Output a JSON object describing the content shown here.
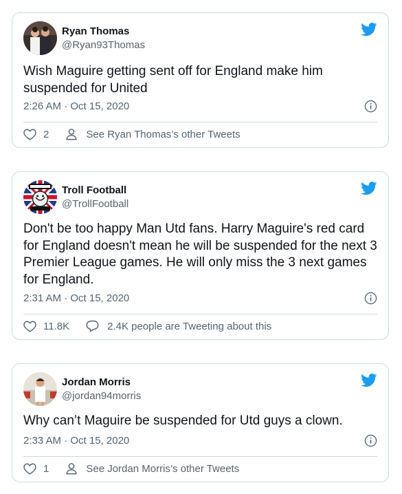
{
  "colors": {
    "twitter_blue": "#1d9bf0",
    "secondary_text": "#536471",
    "border": "#cfd9de"
  },
  "tweets": [
    {
      "name": "Ryan Thomas",
      "handle": "@Ryan93Thomas",
      "text": "Wish Maguire getting sent off for England make him suspended for United",
      "time": "2:26 AM · Oct 15, 2020",
      "likes": "2",
      "second_action_icon": "person-icon",
      "second_action_label": "See Ryan Thomas’s other Tweets"
    },
    {
      "name": "Troll Football",
      "handle": "@TrollFootball",
      "text": "Don't be too happy Man Utd fans. Harry Maguire's red card for England doesn't mean he will be suspended for the next 3 Premier League games. He will only miss the 3 next games for England.",
      "time": "2:31 AM · Oct 15, 2020",
      "likes": "11.8K",
      "second_action_icon": "reply-bubble-icon",
      "second_action_label": "2.4K people are Tweeting about this"
    },
    {
      "name": "Jordan Morris",
      "handle": "@jordan94morris",
      "text": "Why can’t Maguire be suspended for Utd guys a clown.",
      "time": "2:33 AM · Oct 15, 2020",
      "likes": "1",
      "second_action_icon": "person-icon",
      "second_action_label": "See Jordan Morris’s other Tweets"
    }
  ]
}
